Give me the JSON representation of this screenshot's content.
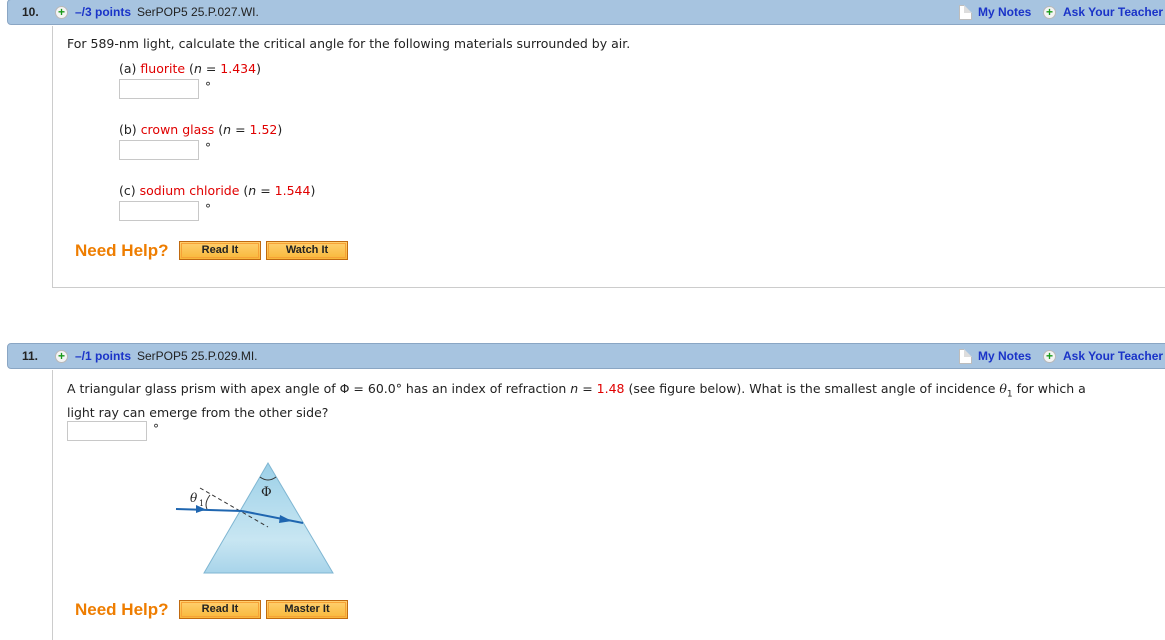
{
  "questions": [
    {
      "number": "10.",
      "points": "–/3 points",
      "code": "SerPOP5 25.P.027.WI.",
      "my_notes": "My Notes",
      "ask_teacher": "Ask Your Teacher",
      "prompt": "For 589-nm light, calculate the critical angle for the following materials surrounded by air.",
      "parts": [
        {
          "label": "(a)",
          "material": "fluorite",
          "n_prefix": "(",
          "n_var": "n",
          "n_eq": " = ",
          "n_value": "1.434",
          "n_suffix": ")",
          "answer": "",
          "unit": "°"
        },
        {
          "label": "(b)",
          "material": "crown glass",
          "n_prefix": "(",
          "n_var": "n",
          "n_eq": " = ",
          "n_value": "1.52",
          "n_suffix": ")",
          "answer": "",
          "unit": "°"
        },
        {
          "label": "(c)",
          "material": "sodium chloride",
          "n_prefix": "(",
          "n_var": "n",
          "n_eq": " = ",
          "n_value": "1.544",
          "n_suffix": ")",
          "answer": "",
          "unit": "°"
        }
      ],
      "need_help": "Need Help?",
      "help_buttons": [
        "Read It",
        "Watch It"
      ]
    },
    {
      "number": "11.",
      "points": "–/1 points",
      "code": "SerPOP5 25.P.029.MI.",
      "my_notes": "My Notes",
      "ask_teacher": "Ask Your Teacher",
      "prompt_part1": "A triangular glass prism with apex angle of Φ = 60.0° has an index of refraction ",
      "prompt_n_var": "n",
      "prompt_n_eq": " = ",
      "prompt_n_value": "1.48",
      "prompt_part2": " (see figure below). What is the smallest angle of incidence ",
      "prompt_theta": "θ",
      "prompt_theta_sub": "1",
      "prompt_part3": " for which a",
      "prompt_line2": "light ray can emerge from the other side?",
      "answer": "",
      "unit": "°",
      "figure": {
        "apex_label": "Φ",
        "angle_label": "θ",
        "angle_sub": "1"
      },
      "need_help": "Need Help?",
      "help_buttons": [
        "Read It",
        "Master It"
      ]
    }
  ],
  "colors": {
    "header_bg": "#a7c4e0",
    "link": "#1a33c8",
    "highlight": "#e00000",
    "need_help": "#ee7d00"
  }
}
